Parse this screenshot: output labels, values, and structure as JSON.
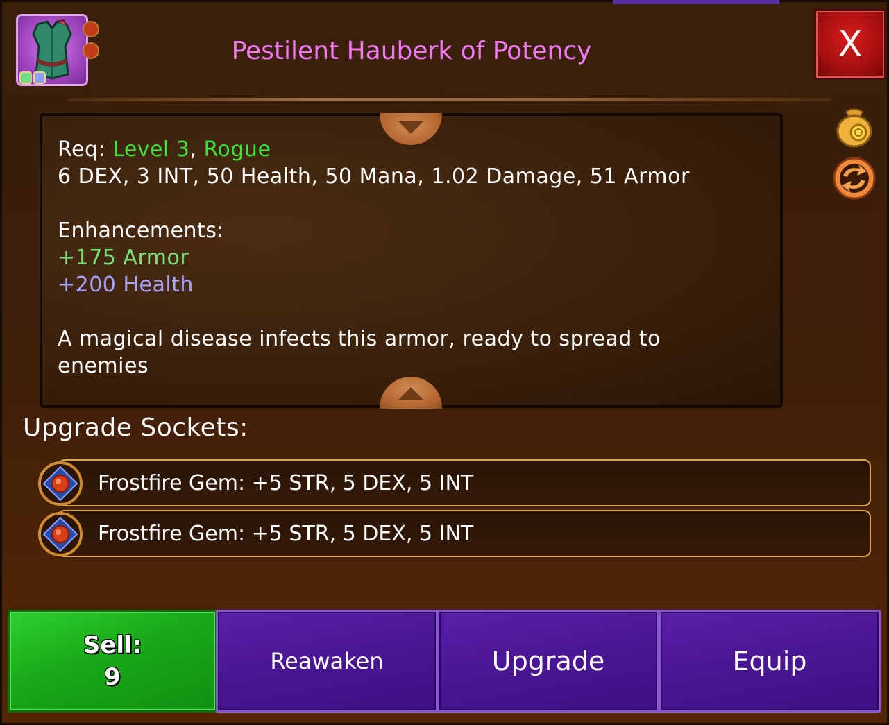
{
  "item": {
    "title": "Pestilent Hauberk of Potency",
    "icon": "armor-vest-icon",
    "colors": {
      "title": "#f279f2",
      "icon_bg": "#b455d2"
    }
  },
  "close_label": "X",
  "description": {
    "req_prefix": "Req: ",
    "req_level": "Level 3",
    "req_sep": ", ",
    "req_class": "Rogue",
    "stats": "6 DEX, 3 INT, 50 Health, 50 Mana, 1.02 Damage, 51 Armor",
    "enhancements_label": "Enhancements:",
    "enhancements": [
      "+175 Armor",
      "+200 Health"
    ],
    "flavor_line1": "A magical disease infects this armor, ready to spread to",
    "flavor_line2": "enemies"
  },
  "sockets": {
    "title": "Upgrade Sockets:",
    "items": [
      {
        "text": "Frostfire Gem: +5 STR, 5 DEX, 5 INT",
        "icon": "frostfire-gem-icon"
      },
      {
        "text": "Frostfire Gem: +5 STR, 5 DEX, 5 INT",
        "icon": "frostfire-gem-icon"
      }
    ]
  },
  "side_icons": [
    "gold-pouch-icon",
    "refresh-arrows-icon"
  ],
  "buttons": {
    "sell_label": "Sell:",
    "sell_value": "9",
    "reawaken_label": "Reawaken",
    "upgrade_label": "Upgrade",
    "equip_label": "Equip"
  }
}
